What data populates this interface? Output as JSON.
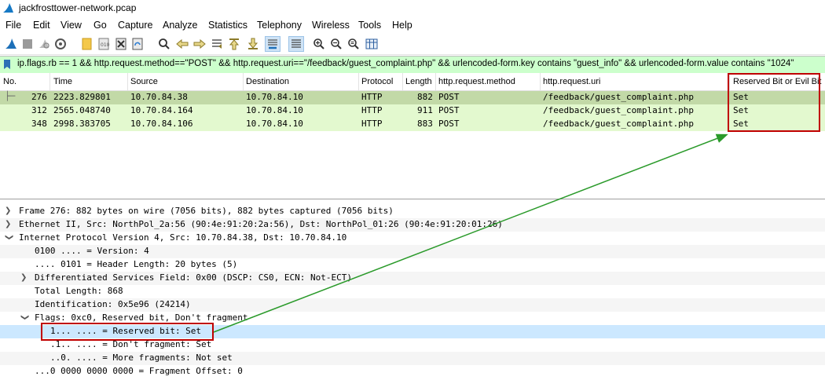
{
  "window": {
    "title": "jackfrosttower-network.pcap"
  },
  "menu": [
    "File",
    "Edit",
    "View",
    "Go",
    "Capture",
    "Analyze",
    "Statistics",
    "Telephony",
    "Wireless",
    "Tools",
    "Help"
  ],
  "toolbar": {
    "icons": [
      "shark-fin-start-icon",
      "stop-icon",
      "restart-icon",
      "capture-options-icon",
      "open-file-icon",
      "save-file-icon",
      "close-file-icon",
      "reload-icon",
      "find-icon",
      "back-icon",
      "forward-icon",
      "goto-packet-icon",
      "first-packet-icon",
      "last-packet-icon",
      "autoscroll-icon",
      "colorize-icon",
      "zoom-in-icon",
      "zoom-out-icon",
      "normal-size-icon",
      "resize-columns-icon"
    ]
  },
  "filter": {
    "value": "ip.flags.rb == 1 && http.request.method==\"POST\" &&  http.request.uri==\"/feedback/guest_complaint.php\" && urlencoded-form.key contains \"guest_info\"  && urlencoded-form.value contains \"1024\""
  },
  "packet_list": {
    "columns": [
      "No.",
      "Time",
      "Source",
      "Destination",
      "Protocol",
      "Length",
      "http.request.method",
      "http.request.uri",
      "Reserved Bit or Evil Bit"
    ],
    "rows": [
      {
        "no": "276",
        "time": "2223.829801",
        "source": "10.70.84.38",
        "destination": "10.70.84.10",
        "protocol": "HTTP",
        "length": "882",
        "method": "POST",
        "uri": "/feedback/guest_complaint.php",
        "rb": "Set"
      },
      {
        "no": "312",
        "time": "2565.048740",
        "source": "10.70.84.164",
        "destination": "10.70.84.10",
        "protocol": "HTTP",
        "length": "911",
        "method": "POST",
        "uri": "/feedback/guest_complaint.php",
        "rb": "Set"
      },
      {
        "no": "348",
        "time": "2998.383705",
        "source": "10.70.84.106",
        "destination": "10.70.84.10",
        "protocol": "HTTP",
        "length": "883",
        "method": "POST",
        "uri": "/feedback/guest_complaint.php",
        "rb": "Set"
      }
    ]
  },
  "details": [
    {
      "text": "Frame 276: 882 bytes on wire (7056 bits), 882 bytes captured (7056 bits)",
      "expander": "collapsed"
    },
    {
      "text": "Ethernet II, Src: NorthPol_2a:56 (90:4e:91:20:2a:56), Dst: NorthPol_01:26 (90:4e:91:20:01:26)",
      "expander": "collapsed"
    },
    {
      "text": "Internet Protocol Version 4, Src: 10.70.84.38, Dst: 10.70.84.10",
      "expander": "expanded"
    },
    {
      "text": "0100 .... = Version: 4",
      "expander": ""
    },
    {
      "text": ".... 0101 = Header Length: 20 bytes (5)",
      "expander": ""
    },
    {
      "text": "Differentiated Services Field: 0x00 (DSCP: CS0, ECN: Not-ECT)",
      "expander": "collapsed"
    },
    {
      "text": "Total Length: 868",
      "expander": ""
    },
    {
      "text": "Identification: 0x5e96 (24214)",
      "expander": ""
    },
    {
      "text": "Flags: 0xc0, Reserved bit, Don't fragment",
      "expander": "expanded"
    },
    {
      "text": "1... .... = Reserved bit: Set",
      "expander": ""
    },
    {
      "text": ".1.. .... = Don't fragment: Set",
      "expander": ""
    },
    {
      "text": "..0. .... = More fragments: Not set",
      "expander": ""
    },
    {
      "text": "...0 0000 0000 0000 = Fragment Offset: 0",
      "expander": ""
    }
  ],
  "colors": {
    "filter_ok": "#ccffcc",
    "selected_row": "#c2d9a7",
    "http_row": "#e3f9cf",
    "detail_highlight": "#cce8ff",
    "annotation_red": "#c00000",
    "annotation_arrow": "#2a9a2a"
  }
}
